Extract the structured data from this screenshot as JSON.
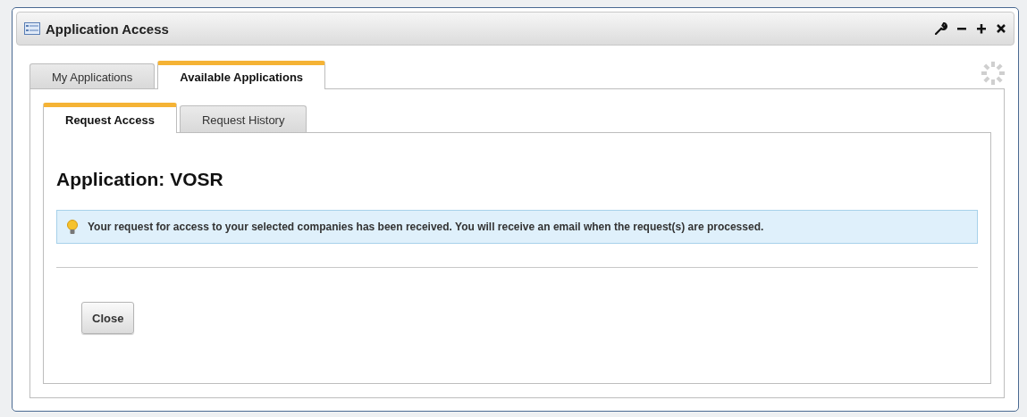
{
  "window": {
    "title": "Application Access"
  },
  "tabs": [
    {
      "label": "My Applications",
      "selected": false
    },
    {
      "label": "Available Applications",
      "selected": true
    }
  ],
  "subtabs": [
    {
      "label": "Request Access",
      "selected": true
    },
    {
      "label": "Request History",
      "selected": false
    }
  ],
  "heading": "Application: VOSR",
  "notice": "Your request for access to your selected companies has been received. You will receive an email when the request(s) are processed.",
  "buttons": [
    "Close"
  ]
}
